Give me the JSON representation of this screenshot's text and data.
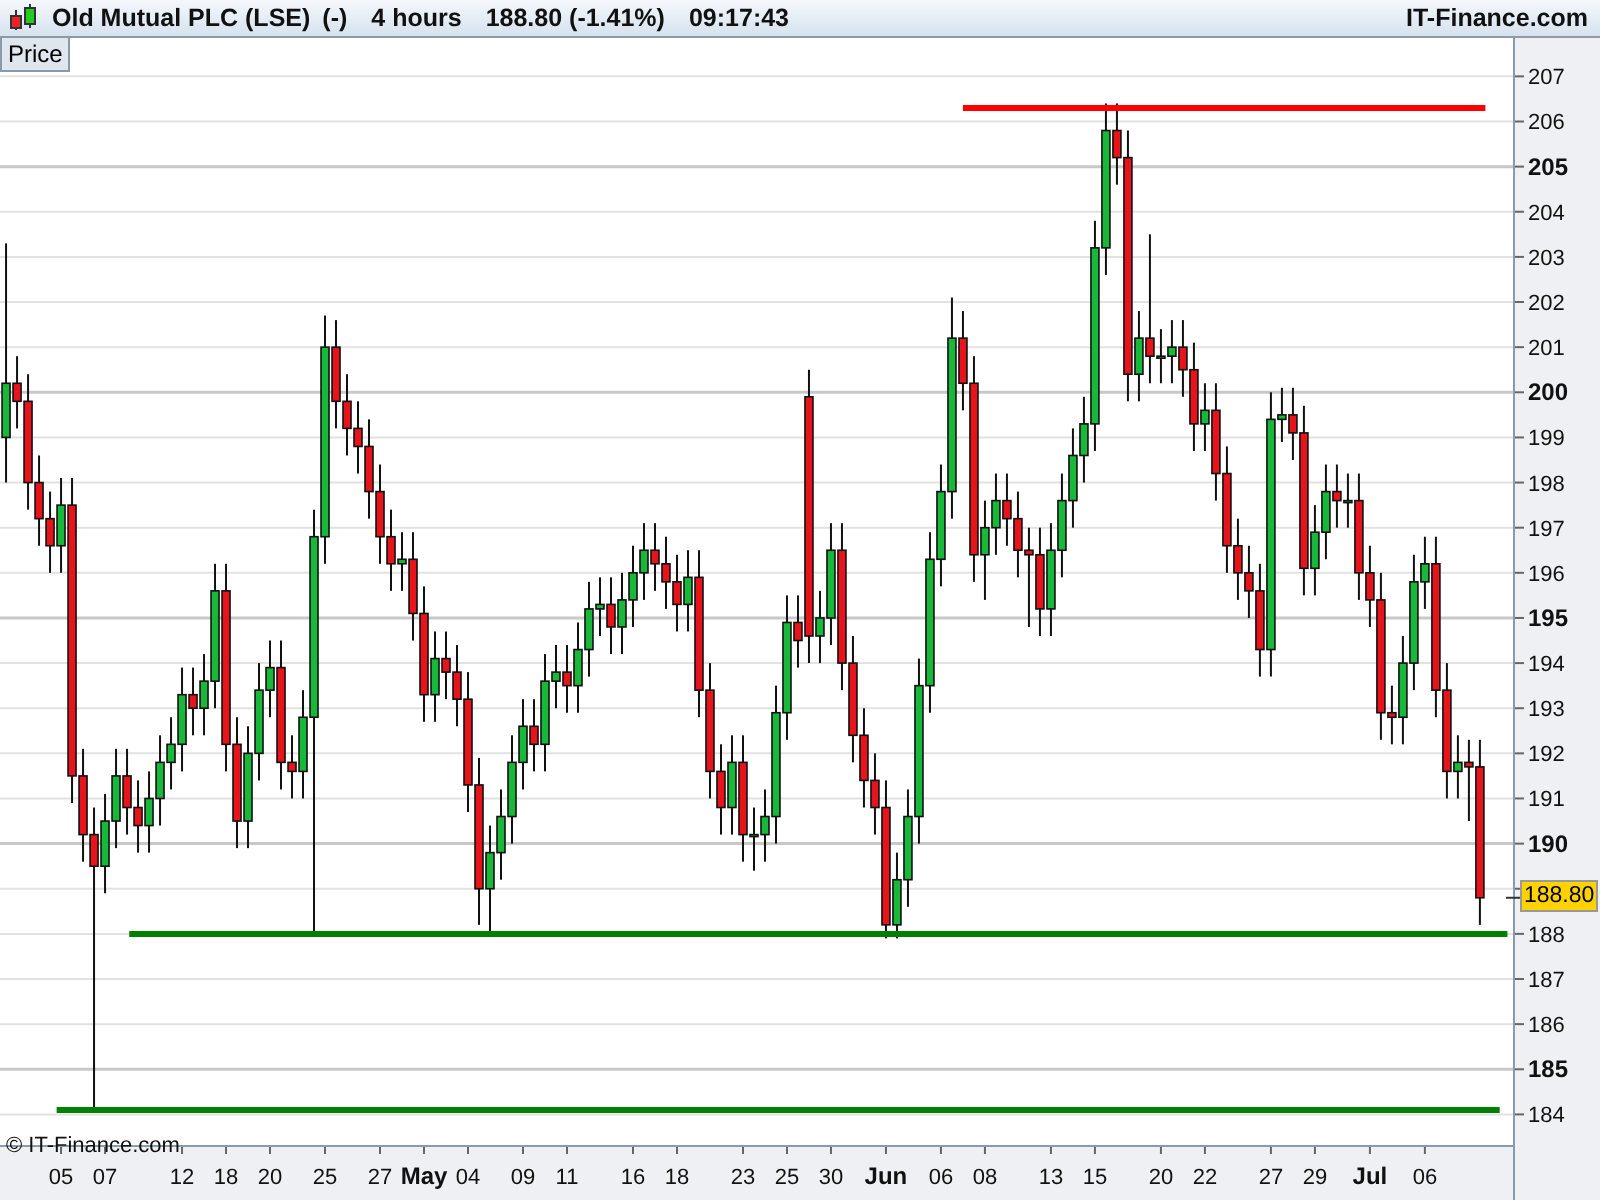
{
  "header": {
    "instrument": "Old Mutual PLC (LSE)",
    "change_flag": "(-)",
    "interval": "4 hours",
    "last": "188.80 (-1.41%)",
    "time": "09:17:43",
    "brand": "IT-Finance.com"
  },
  "panel_tab": {
    "label": "Price"
  },
  "copyright": "© IT-Finance.com",
  "last_price_tag": "188.80",
  "chart": {
    "chart_data": {
      "type": "candlestick",
      "grid": true,
      "ylim": [
        183.3,
        207.85
      ],
      "yticks": [
        184,
        185,
        186,
        187,
        188,
        190,
        191,
        192,
        193,
        194,
        195,
        196,
        197,
        198,
        199,
        200,
        201,
        202,
        203,
        204,
        205,
        206,
        207
      ],
      "categories": [
        null,
        null,
        null,
        null,
        null,
        "05",
        null,
        null,
        null,
        "07",
        null,
        null,
        null,
        null,
        null,
        null,
        "12",
        null,
        null,
        null,
        "18",
        null,
        null,
        null,
        "20",
        null,
        null,
        null,
        null,
        "25",
        null,
        null,
        null,
        null,
        "27",
        null,
        null,
        null,
        "May",
        null,
        null,
        null,
        "04",
        null,
        null,
        null,
        null,
        "09",
        null,
        null,
        null,
        "11",
        null,
        null,
        null,
        null,
        null,
        "16",
        null,
        null,
        null,
        "18",
        null,
        null,
        null,
        null,
        null,
        "23",
        null,
        null,
        null,
        "25",
        null,
        null,
        null,
        "30",
        null,
        null,
        null,
        null,
        "Jun",
        null,
        null,
        null,
        null,
        "06",
        null,
        null,
        null,
        "08",
        null,
        null,
        null,
        null,
        null,
        "13",
        null,
        null,
        null,
        "15",
        null,
        null,
        null,
        null,
        null,
        "20",
        null,
        null,
        null,
        "22",
        null,
        null,
        null,
        null,
        null,
        "27",
        null,
        null,
        null,
        "29",
        null,
        null,
        null,
        null,
        "Jul",
        null,
        null,
        null,
        null,
        "06",
        null,
        null,
        null,
        null,
        null
      ],
      "ohlc": [
        [
          199,
          203.3,
          198,
          200.2
        ],
        [
          200.2,
          200.8,
          199.2,
          199.8
        ],
        [
          199.8,
          200.4,
          197.4,
          198
        ],
        [
          198,
          198.6,
          196.6,
          197.2
        ],
        [
          197.2,
          197.8,
          196,
          196.6
        ],
        [
          196.6,
          198.1,
          196,
          197.5
        ],
        [
          197.5,
          198.1,
          190.9,
          191.5
        ],
        [
          191.5,
          192.1,
          189.6,
          190.2
        ],
        [
          190.2,
          190.8,
          184.1,
          189.5
        ],
        [
          189.5,
          191.1,
          188.9,
          190.5
        ],
        [
          190.5,
          192.1,
          189.9,
          191.5
        ],
        [
          191.5,
          192.1,
          190.2,
          190.8
        ],
        [
          190.8,
          191.4,
          189.8,
          190.4
        ],
        [
          190.4,
          191.6,
          189.8,
          191
        ],
        [
          191,
          192.4,
          190.4,
          191.8
        ],
        [
          191.8,
          192.8,
          191.2,
          192.2
        ],
        [
          192.2,
          193.9,
          191.6,
          193.3
        ],
        [
          193.3,
          193.9,
          192.4,
          193
        ],
        [
          193,
          194.2,
          192.4,
          193.6
        ],
        [
          193.6,
          196.2,
          193,
          195.6
        ],
        [
          195.6,
          196.2,
          191.6,
          192.2
        ],
        [
          192.2,
          192.8,
          189.9,
          190.5
        ],
        [
          190.5,
          192.6,
          189.9,
          192
        ],
        [
          192,
          194,
          191.4,
          193.4
        ],
        [
          193.4,
          194.5,
          192.8,
          193.9
        ],
        [
          193.9,
          194.5,
          191.2,
          191.8
        ],
        [
          191.8,
          192.4,
          191,
          191.6
        ],
        [
          191.6,
          193.4,
          191,
          192.8
        ],
        [
          192.8,
          197.4,
          188,
          196.8
        ],
        [
          196.8,
          201.7,
          196.2,
          201
        ],
        [
          201,
          201.6,
          199.2,
          199.8
        ],
        [
          199.8,
          200.4,
          198.6,
          199.2
        ],
        [
          199.2,
          199.8,
          198.2,
          198.8
        ],
        [
          198.8,
          199.4,
          197.2,
          197.8
        ],
        [
          197.8,
          198.4,
          196.2,
          196.8
        ],
        [
          196.8,
          197.4,
          195.6,
          196.2
        ],
        [
          196.2,
          196.9,
          195.6,
          196.3
        ],
        [
          196.3,
          196.9,
          194.5,
          195.1
        ],
        [
          195.1,
          195.7,
          192.7,
          193.3
        ],
        [
          193.3,
          194.7,
          192.7,
          194.1
        ],
        [
          194.1,
          194.7,
          193.2,
          193.8
        ],
        [
          193.8,
          194.4,
          192.6,
          193.2
        ],
        [
          193.2,
          193.8,
          190.7,
          191.3
        ],
        [
          191.3,
          191.9,
          188.2,
          189
        ],
        [
          189,
          190.4,
          188,
          189.8
        ],
        [
          189.8,
          191.2,
          189.2,
          190.6
        ],
        [
          190.6,
          192.4,
          190,
          191.8
        ],
        [
          191.8,
          193.2,
          191.2,
          192.6
        ],
        [
          192.6,
          193.2,
          191.6,
          192.2
        ],
        [
          192.2,
          194.2,
          191.6,
          193.6
        ],
        [
          193.6,
          194.4,
          193,
          193.8
        ],
        [
          193.8,
          194.4,
          192.9,
          193.5
        ],
        [
          193.5,
          194.9,
          192.9,
          194.3
        ],
        [
          194.3,
          195.8,
          193.7,
          195.2
        ],
        [
          195.2,
          195.9,
          194.6,
          195.3
        ],
        [
          195.3,
          195.9,
          194.2,
          194.8
        ],
        [
          194.8,
          196,
          194.2,
          195.4
        ],
        [
          195.4,
          196.6,
          194.8,
          196
        ],
        [
          196,
          197.1,
          195.4,
          196.5
        ],
        [
          196.5,
          197.1,
          195.6,
          196.2
        ],
        [
          196.2,
          196.8,
          195.2,
          195.8
        ],
        [
          195.8,
          196.4,
          194.7,
          195.3
        ],
        [
          195.3,
          196.5,
          194.7,
          195.9
        ],
        [
          195.9,
          196.5,
          192.8,
          193.4
        ],
        [
          193.4,
          194,
          191,
          191.6
        ],
        [
          191.6,
          192.2,
          190.2,
          190.8
        ],
        [
          190.8,
          192.4,
          190.2,
          191.8
        ],
        [
          191.8,
          192.4,
          189.6,
          190.2
        ],
        [
          190.2,
          190.8,
          189.4,
          190.2
        ],
        [
          190.2,
          191.2,
          189.6,
          190.6
        ],
        [
          190.6,
          193.5,
          190,
          192.9
        ],
        [
          192.9,
          195.5,
          192.3,
          194.9
        ],
        [
          194.9,
          195.5,
          193.9,
          194.5
        ],
        [
          199.9,
          200.5,
          194,
          194.6
        ],
        [
          194.6,
          195.6,
          194,
          195
        ],
        [
          195,
          197.1,
          194.4,
          196.5
        ],
        [
          196.5,
          197.1,
          193.4,
          194
        ],
        [
          194,
          194.6,
          191.8,
          192.4
        ],
        [
          192.4,
          193,
          190.8,
          191.4
        ],
        [
          191.4,
          192,
          190.2,
          190.8
        ],
        [
          190.8,
          191.4,
          187.9,
          188.2
        ],
        [
          188.2,
          189.8,
          187.9,
          189.2
        ],
        [
          189.2,
          191.2,
          188.6,
          190.6
        ],
        [
          190.6,
          194.1,
          190,
          193.5
        ],
        [
          193.5,
          196.9,
          192.9,
          196.3
        ],
        [
          196.3,
          198.4,
          195.7,
          197.8
        ],
        [
          197.8,
          202.1,
          197.2,
          201.2
        ],
        [
          201.2,
          201.8,
          199.6,
          200.2
        ],
        [
          200.2,
          200.8,
          195.8,
          196.4
        ],
        [
          196.4,
          197.6,
          195.4,
          197
        ],
        [
          197,
          198.2,
          196.4,
          197.6
        ],
        [
          197.6,
          198.2,
          196.6,
          197.2
        ],
        [
          197.2,
          197.8,
          195.9,
          196.5
        ],
        [
          196.5,
          197,
          194.8,
          196.4
        ],
        [
          196.4,
          197,
          194.6,
          195.2
        ],
        [
          195.2,
          197.1,
          194.6,
          196.5
        ],
        [
          196.5,
          198.2,
          195.9,
          197.6
        ],
        [
          197.6,
          199.2,
          197,
          198.6
        ],
        [
          198.6,
          199.9,
          198,
          199.3
        ],
        [
          199.3,
          203.8,
          198.7,
          203.2
        ],
        [
          203.2,
          206.4,
          202.6,
          205.8
        ],
        [
          205.8,
          206.4,
          204.6,
          205.2
        ],
        [
          205.2,
          205.8,
          199.8,
          200.4
        ],
        [
          200.4,
          201.8,
          199.8,
          201.2
        ],
        [
          201.2,
          203.5,
          200.2,
          200.8
        ],
        [
          200.8,
          201.4,
          200.2,
          200.8
        ],
        [
          200.8,
          201.6,
          200.2,
          201
        ],
        [
          201,
          201.6,
          199.9,
          200.5
        ],
        [
          200.5,
          201.1,
          198.7,
          199.3
        ],
        [
          199.3,
          200.2,
          198.7,
          199.6
        ],
        [
          199.6,
          200.2,
          197.6,
          198.2
        ],
        [
          198.2,
          198.8,
          196,
          196.6
        ],
        [
          196.6,
          197.2,
          195.4,
          196
        ],
        [
          196,
          196.6,
          195,
          195.6
        ],
        [
          195.6,
          196.2,
          193.7,
          194.3
        ],
        [
          194.3,
          200,
          193.7,
          199.4
        ],
        [
          199.4,
          200.1,
          198.9,
          199.5
        ],
        [
          199.5,
          200.1,
          198.5,
          199.1
        ],
        [
          199.1,
          199.7,
          195.5,
          196.1
        ],
        [
          196.1,
          197.5,
          195.5,
          196.9
        ],
        [
          196.9,
          198.4,
          196.3,
          197.8
        ],
        [
          197.8,
          198.4,
          197,
          197.6
        ],
        [
          197.6,
          198.2,
          197,
          197.6
        ],
        [
          197.6,
          198.2,
          195.4,
          196
        ],
        [
          196,
          196.6,
          194.8,
          195.4
        ],
        [
          195.4,
          196,
          192.3,
          192.9
        ],
        [
          192.9,
          193.5,
          192.2,
          192.8
        ],
        [
          192.8,
          194.6,
          192.2,
          194
        ],
        [
          194,
          196.4,
          193.4,
          195.8
        ],
        [
          195.8,
          196.8,
          195.2,
          196.2
        ],
        [
          196.2,
          196.8,
          192.8,
          193.4
        ],
        [
          193.4,
          194,
          191,
          191.6
        ],
        [
          191.6,
          192.4,
          191,
          191.8
        ],
        [
          191.8,
          192.3,
          190.5,
          191.7
        ],
        [
          191.7,
          192.3,
          188.2,
          188.8
        ]
      ],
      "ref_lines": [
        {
          "axis": "y",
          "value": 206.3,
          "color": "#ff0000"
        },
        {
          "axis": "y",
          "value": 188,
          "color": "#008000"
        },
        {
          "axis": "y",
          "value": 184.1,
          "color": "#008000"
        }
      ]
    }
  }
}
